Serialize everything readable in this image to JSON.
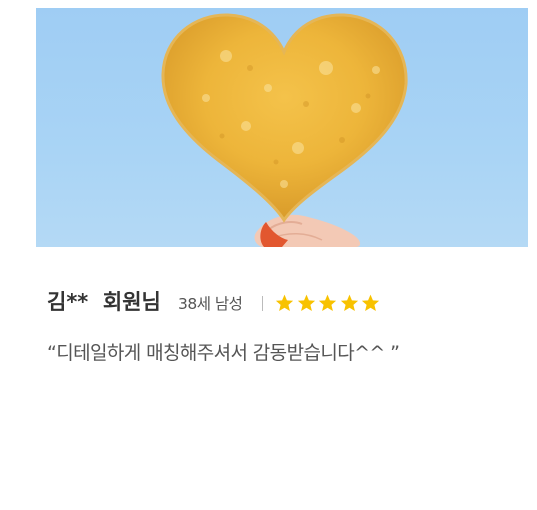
{
  "review": {
    "photo": {
      "subject": "heart-shaped chip held against blue sky"
    },
    "reviewer_name": "김**  회원님",
    "age_gender": "38세 남성",
    "rating": 5,
    "rating_max": 5,
    "star_color": "#f8c200",
    "comment": "“디테일하게 매칭해주셔서 감동받습니다^^ ”"
  }
}
